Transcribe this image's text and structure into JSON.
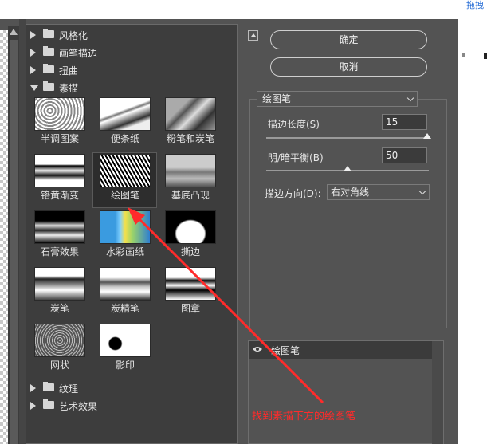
{
  "header": {
    "tab_label": "拖拽"
  },
  "filter_gallery": {
    "categories_top": [
      {
        "label": "风格化",
        "expanded": false
      },
      {
        "label": "画笔描边",
        "expanded": false
      },
      {
        "label": "扭曲",
        "expanded": false
      },
      {
        "label": "素描",
        "expanded": true
      }
    ],
    "sketch_filters": [
      {
        "label": "半调图案",
        "icon": "halftone-pattern-thumbnail"
      },
      {
        "label": "便条纸",
        "icon": "note-paper-thumbnail"
      },
      {
        "label": "粉笔和炭笔",
        "icon": "chalk-charcoal-thumbnail"
      },
      {
        "label": "铬黄渐变",
        "icon": "chrome-thumbnail"
      },
      {
        "label": "绘图笔",
        "icon": "graphic-pen-thumbnail",
        "selected": true
      },
      {
        "label": "基底凸现",
        "icon": "bas-relief-thumbnail"
      },
      {
        "label": "石膏效果",
        "icon": "plaster-thumbnail"
      },
      {
        "label": "水彩画纸",
        "icon": "water-paper-thumbnail"
      },
      {
        "label": "撕边",
        "icon": "torn-edges-thumbnail"
      },
      {
        "label": "炭笔",
        "icon": "charcoal-thumbnail"
      },
      {
        "label": "炭精笔",
        "icon": "conte-crayon-thumbnail"
      },
      {
        "label": "图章",
        "icon": "stamp-thumbnail"
      },
      {
        "label": "网状",
        "icon": "reticulation-thumbnail"
      },
      {
        "label": "影印",
        "icon": "photocopy-thumbnail"
      }
    ],
    "categories_bottom": [
      {
        "label": "纹理",
        "expanded": false
      },
      {
        "label": "艺术效果",
        "expanded": false
      }
    ]
  },
  "buttons": {
    "ok": "确定",
    "cancel": "取消"
  },
  "settings": {
    "filter_select": "绘图笔",
    "stroke_length": {
      "label": "描边长度(S)",
      "value": "15",
      "slider_fraction": 1.0
    },
    "light_dark_balance": {
      "label": "明/暗平衡(B)",
      "value": "50",
      "slider_fraction": 0.5
    },
    "stroke_direction": {
      "label": "描边方向(D):",
      "value": "右对角线"
    }
  },
  "layers": {
    "items": [
      {
        "label": "绘图笔",
        "visible": true
      }
    ]
  },
  "annotation": {
    "text": "找到素描下方的绘图笔",
    "color": "#ff2b2b"
  }
}
